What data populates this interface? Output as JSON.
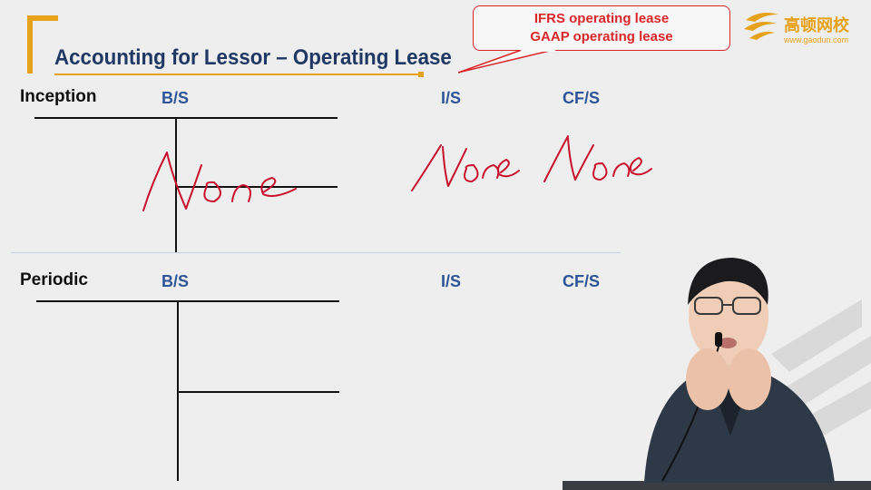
{
  "slide": {
    "title": "Accounting for Lessor – Operating Lease",
    "callout": {
      "line1": "IFRS operating lease",
      "line2": "GAAP operating lease"
    },
    "logo": {
      "name": "高顿网校",
      "url": "www.gaodun.com",
      "icon": "gaodun-logo-icon",
      "color": "#e7a21b"
    },
    "colors": {
      "title": "#1f3864",
      "column_headers": "#2e5597",
      "callout": "#d9262b",
      "handwriting": "#c8102e",
      "accent": "#e7a21b"
    },
    "sections": [
      {
        "label": "Inception",
        "columns": [
          "B/S",
          "I/S",
          "CF/S"
        ],
        "handwritten": [
          "None",
          "None",
          "None"
        ]
      },
      {
        "label": "Periodic",
        "columns": [
          "B/S",
          "I/S",
          "CF/S"
        ]
      }
    ]
  }
}
